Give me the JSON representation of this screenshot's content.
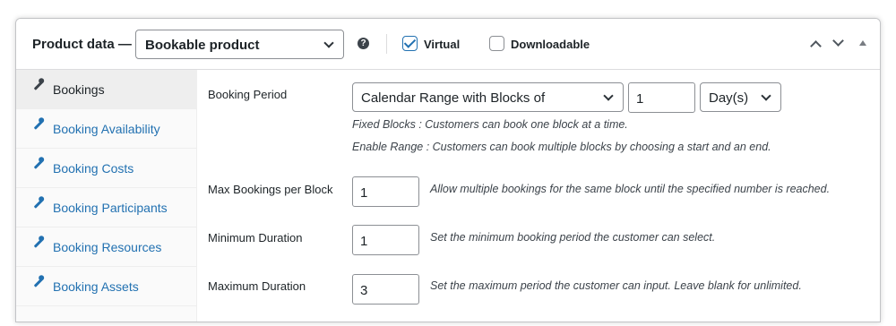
{
  "header": {
    "title": "Product data —",
    "product_type": "Bookable product",
    "help_symbol": "?",
    "virtual_label": "Virtual",
    "virtual_checked": true,
    "downloadable_label": "Downloadable",
    "downloadable_checked": false
  },
  "sidebar": {
    "active": "Bookings",
    "items": [
      {
        "label": "Bookings",
        "icon": "wrench-icon"
      },
      {
        "label": "Booking Availability",
        "icon": "wrench-icon"
      },
      {
        "label": "Booking Costs",
        "icon": "wrench-icon"
      },
      {
        "label": "Booking Participants",
        "icon": "wrench-icon"
      },
      {
        "label": "Booking Resources",
        "icon": "wrench-icon"
      },
      {
        "label": "Booking Assets",
        "icon": "wrench-icon"
      }
    ]
  },
  "fields": {
    "booking_period": {
      "label": "Booking Period",
      "mode": "Calendar Range with Blocks of",
      "block_value": "1",
      "unit": "Day(s)",
      "help1": "Fixed Blocks : Customers can book one block at a time.",
      "help2": "Enable Range : Customers can book multiple blocks by choosing a start and an end."
    },
    "max_bookings": {
      "label": "Max Bookings per Block",
      "value": "1",
      "help": "Allow multiple bookings for the same block until the specified number is reached."
    },
    "min_duration": {
      "label": "Minimum Duration",
      "value": "1",
      "help": "Set the minimum booking period the customer can select."
    },
    "max_duration": {
      "label": "Maximum Duration",
      "value": "3",
      "help": "Set the maximum period the customer can input. Leave blank for unlimited."
    }
  },
  "colors": {
    "accent": "#2271b1",
    "text": "#1d2327",
    "border": "#8c8f94",
    "sidebar_bg": "#fafafa",
    "active_tab_bg": "#eeeeee"
  }
}
